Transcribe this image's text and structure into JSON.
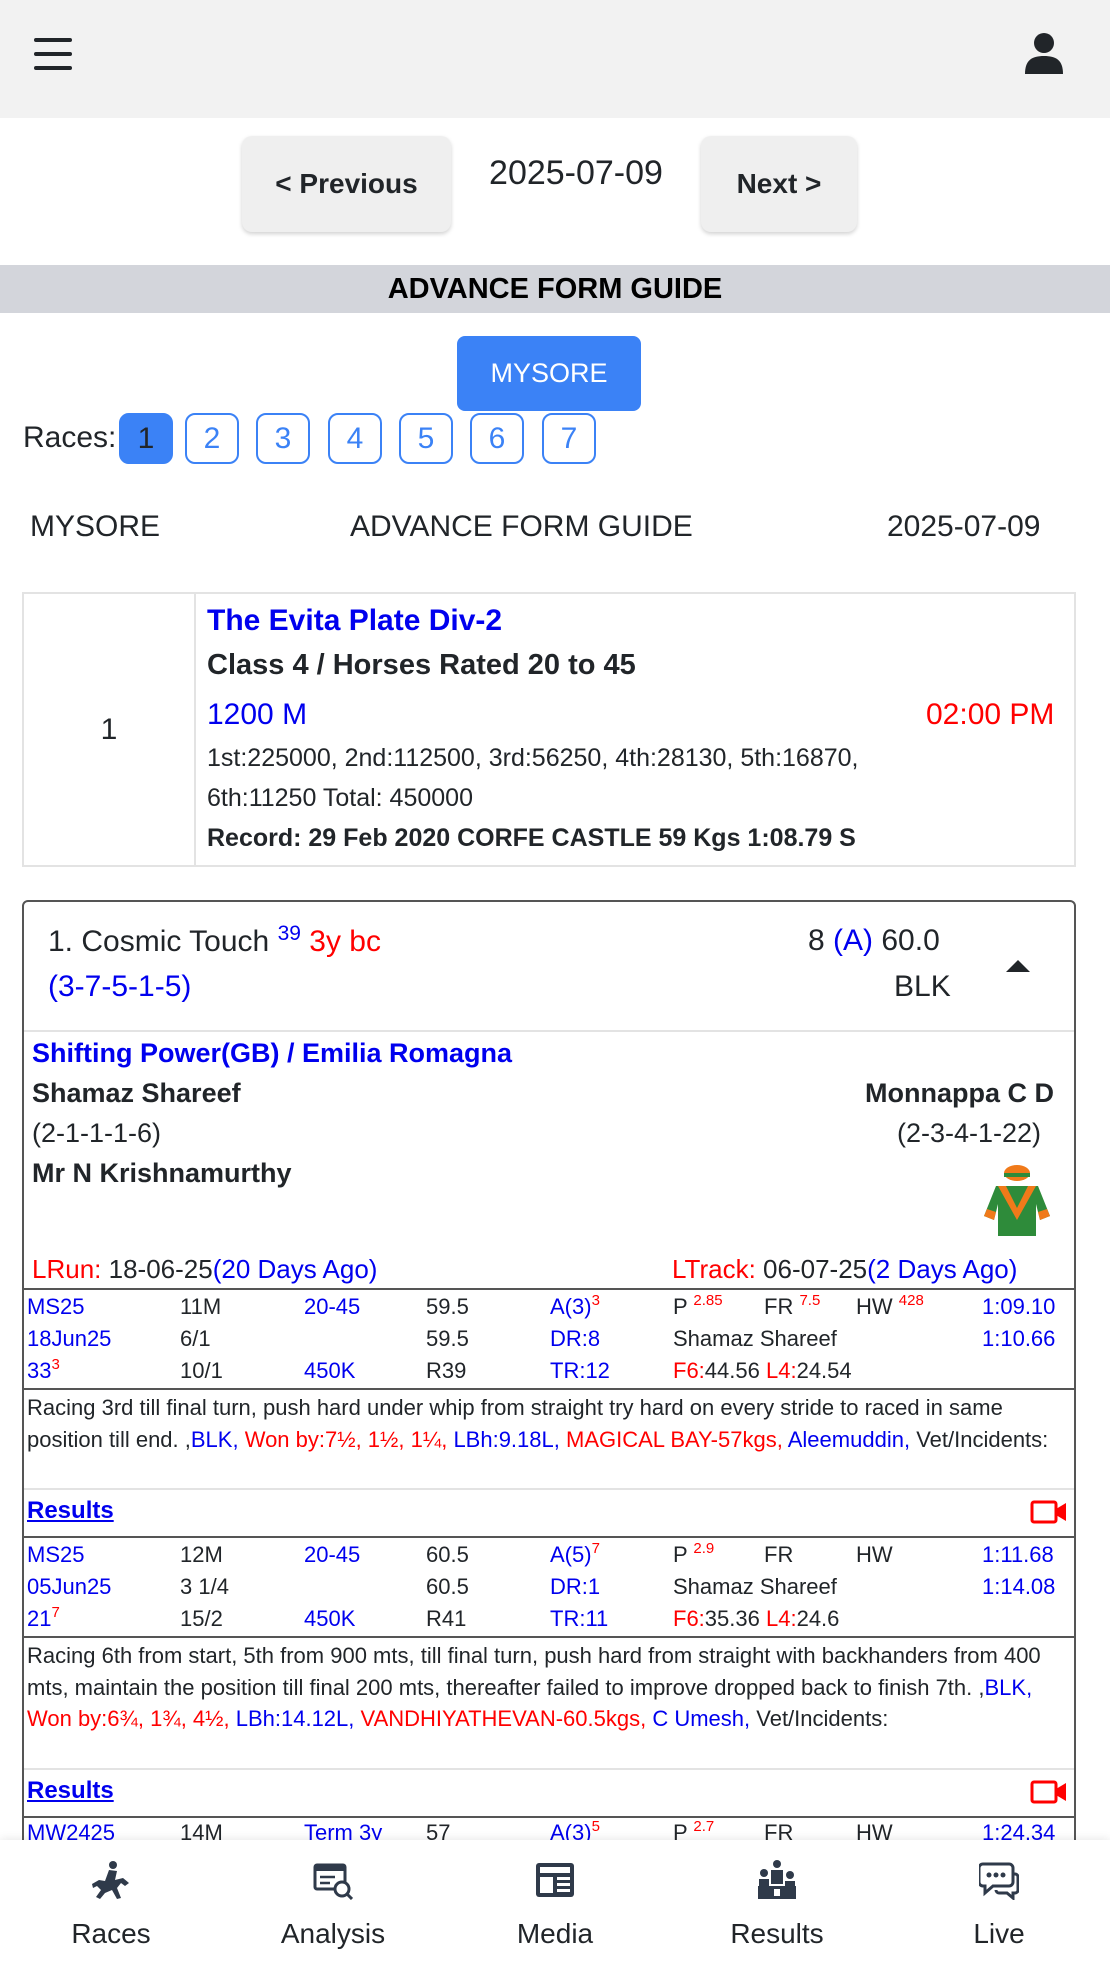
{
  "header": {
    "menu_icon": "hamburger-menu-icon",
    "user_icon": "user-icon"
  },
  "date_nav": {
    "prev_label": "< Previous",
    "date": "2025-07-09",
    "next_label": "Next >"
  },
  "banner": {
    "title": "ADVANCE FORM GUIDE"
  },
  "venue_button": "MYSORE",
  "races": {
    "label": "Races:",
    "items": [
      "1",
      "2",
      "3",
      "4",
      "5",
      "6",
      "7"
    ],
    "active": "1"
  },
  "info_row": {
    "venue": "MYSORE",
    "title": "ADVANCE FORM GUIDE",
    "date": "2025-07-09"
  },
  "race": {
    "number": "1",
    "name": "The Evita Plate Div-2",
    "class": "Class 4 / Horses Rated 20 to 45",
    "distance": "1200 M",
    "time": "02:00 PM",
    "prizes_line1": "1st:225000, 2nd:112500, 3rd:56250, 4th:28130, 5th:16870,",
    "prizes_line2": "6th:11250 Total: 450000",
    "record": "Record: 29 Feb 2020 CORFE CASTLE 59 Kgs 1:08.79 S"
  },
  "horse": {
    "name": "1. Cosmic Touch",
    "rating": "39",
    "age_sex": "3y bc",
    "recent_form": "(3-7-5-1-5)",
    "draw": "8",
    "apprentice": "(A)",
    "weight": "60.0",
    "equipment": "BLK",
    "pedigree": "Shifting Power(GB) / Emilia Romagna",
    "trainer": "Shamaz Shareef",
    "trainer_stats": "(2-1-1-1-6)",
    "jockey": "Monnappa C D",
    "jockey_stats": "(2-3-4-1-22)",
    "owner": "Mr N Krishnamurthy",
    "silks_colors": [
      "#2e8b3a",
      "#f07a1a"
    ],
    "lrun_label": "LRun:",
    "lrun_date": "18-06-25",
    "lrun_ago": "(20 Days Ago)",
    "ltrack_label": "LTrack:",
    "ltrack_date": "06-07-25",
    "ltrack_ago": "(2 Days Ago)"
  },
  "runs": [
    {
      "code": "MS25",
      "dist": "11M",
      "cls": "20-45",
      "wt1": "59.5",
      "a": "A(3)",
      "a_sup": "3",
      "p": "P",
      "p_sup": "2.85",
      "fr": "FR",
      "fr_sup": "7.5",
      "hw": "HW",
      "hw_sup": "428",
      "time1": "1:09.10",
      "date": "18Jun25",
      "margin": "6/1",
      "wt2": "59.5",
      "dr": "DR:8",
      "jockey": "Shamaz Shareef",
      "time2": "1:10.66",
      "pos": "33",
      "pos_sup": "3",
      "odds": "10/1",
      "stake": "450K",
      "rating": "R39",
      "tr": "TR:12",
      "f6_label": "F6:",
      "f6": "44.56",
      "l4_label": "L4:",
      "l4": "24.54",
      "comment": "Racing 3rd till final turn, push hard under whip from straight try hard on every stride to raced in same position till end. ,",
      "equip": "BLK,",
      "won_by": "Won by:7½, 1½, 1¼,",
      "lbh": "LBh:9.18L,",
      "winner": "MAGICAL BAY-57kgs,",
      "winner_jockey": "Aleemuddin,",
      "vet": "Vet/Incidents:",
      "results_label": "Results",
      "video_icon": "video-camera-icon"
    },
    {
      "code": "MS25",
      "dist": "12M",
      "cls": "20-45",
      "wt1": "60.5",
      "a": "A(5)",
      "a_sup": "7",
      "p": "P",
      "p_sup": "2.9",
      "fr": "FR",
      "fr_sup": "",
      "hw": "HW",
      "hw_sup": "",
      "time1": "1:11.68",
      "date": "05Jun25",
      "margin": "3 1/4",
      "wt2": "60.5",
      "dr": "DR:1",
      "jockey": "Shamaz Shareef",
      "time2": "1:14.08",
      "pos": "21",
      "pos_sup": "7",
      "odds": "15/2",
      "stake": "450K",
      "rating": "R41",
      "tr": "TR:11",
      "f6_label": "F6:",
      "f6": "35.36",
      "l4_label": "L4:",
      "l4": "24.6",
      "comment": "Racing 6th from start, 5th from 900 mts, till final turn, push hard from straight with backhanders from 400 mts, maintain the position till final 200 mts, thereafter failed to improve dropped back to finish 7th. ,",
      "equip": "BLK,",
      "won_by": "Won by:6¾, 1¾, 4½,",
      "lbh": "LBh:14.12L,",
      "winner": "VANDHIYATHEVAN-60.5kgs,",
      "winner_jockey": "C Umesh,",
      "vet": "Vet/Incidents:",
      "results_label": "Results",
      "video_icon": "video-camera-icon"
    },
    {
      "code": "MW2425",
      "dist": "14M",
      "cls": "Term 3y",
      "wt1": "57",
      "a": "A(3)",
      "a_sup": "5",
      "p": "P",
      "p_sup": "2.7",
      "fr": "FR",
      "hw": "HW",
      "time1": "1:24.34"
    }
  ],
  "bottom_nav": [
    {
      "label": "Races",
      "icon": "horse-rider-icon"
    },
    {
      "label": "Analysis",
      "icon": "analysis-icon"
    },
    {
      "label": "Media",
      "icon": "media-newspaper-icon"
    },
    {
      "label": "Results",
      "icon": "results-podium-icon"
    },
    {
      "label": "Live",
      "icon": "live-chat-icon"
    }
  ]
}
